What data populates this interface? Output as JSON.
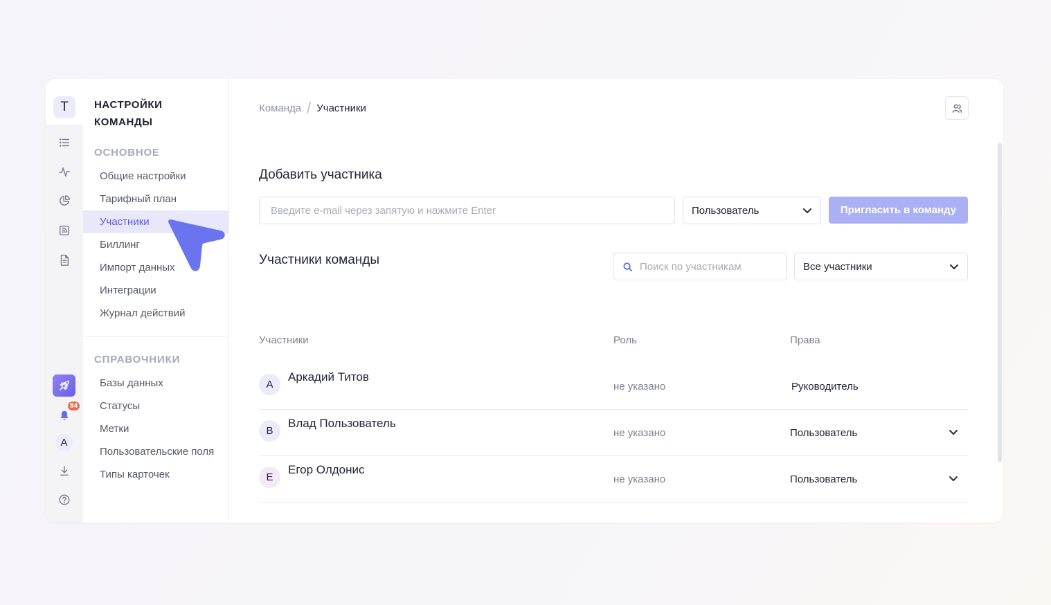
{
  "rail": {
    "team_initial": "T",
    "notifications_count": "84",
    "user_initial": "A"
  },
  "nav": {
    "title": "НАСТРОЙКИ КОМАНДЫ",
    "section_main": "ОСНОВНОЕ",
    "main_items": [
      "Общие настройки",
      "Тарифный план",
      "Участники",
      "Биллинг",
      "Импорт данных",
      "Интеграции",
      "Журнал действий"
    ],
    "section_refs": "СПРАВОЧНИКИ",
    "ref_items": [
      "Базы данных",
      "Статусы",
      "Метки",
      "Пользовательские поля",
      "Типы карточек"
    ]
  },
  "breadcrumb": {
    "parent": "Команда",
    "separator": "/",
    "current": "Участники"
  },
  "add": {
    "heading": "Добавить участника",
    "email_placeholder": "Введите e-mail через запятую и нажмите Enter",
    "role_value": "Пользователь",
    "invite_label": "Пригласить в команду"
  },
  "team": {
    "heading": "Участники команды",
    "search_placeholder": "Поиск по участникам",
    "filter_value": "Все участники",
    "columns": {
      "members": "Участники",
      "role": "Роль",
      "rights": "Права"
    },
    "members": [
      {
        "initial": "А",
        "name": "Аркадий Титов",
        "role": "не указано",
        "rights": "Руководитель"
      },
      {
        "initial": "В",
        "name": "Влад Пользователь",
        "role": "не указано",
        "rights": "Пользователь"
      },
      {
        "initial": "Е",
        "name": "Егор Олдонис",
        "role": "не указано",
        "rights": "Пользователь"
      }
    ]
  },
  "colors": {
    "accent": "#5c6ff0",
    "active_bg": "#e8e8fa",
    "invite_bg": "#aab0f3",
    "badge": "#ea6a4f"
  }
}
